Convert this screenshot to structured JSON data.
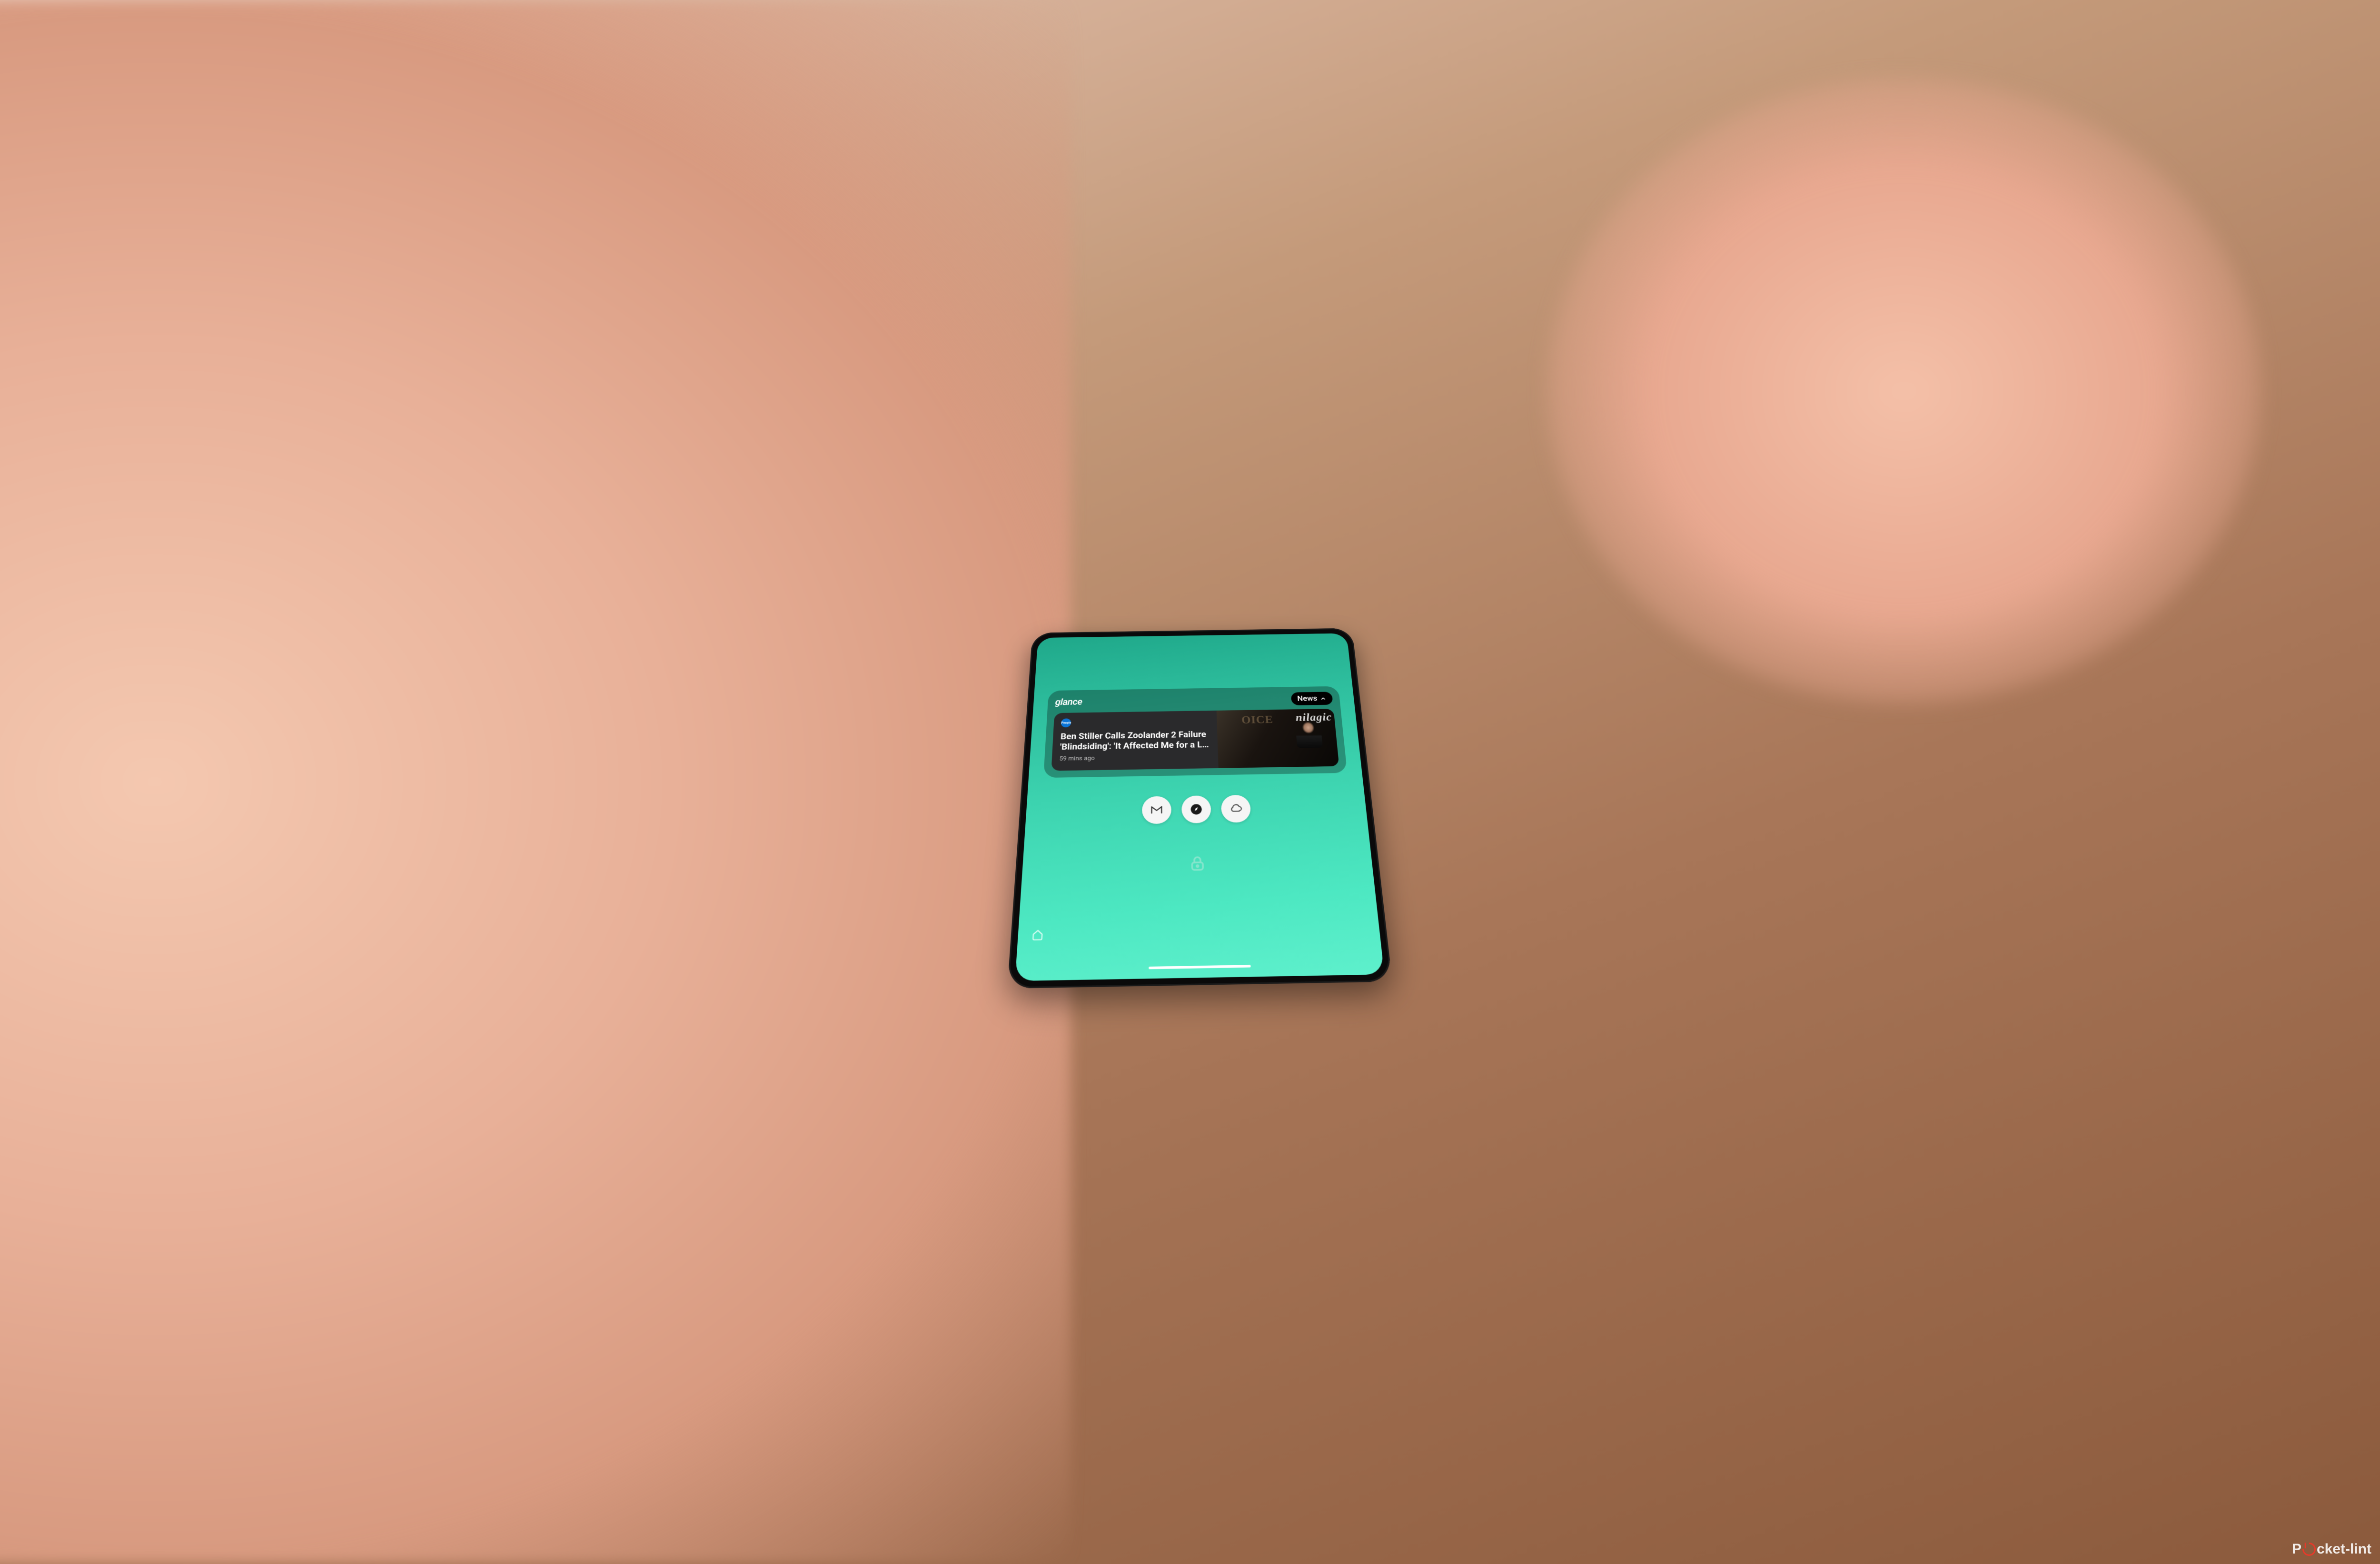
{
  "widget": {
    "brand": "glance",
    "category_label": "News",
    "publisher": "People",
    "headline": "Ben Stiller Calls Zoolander 2 Failure 'Blindsiding': 'It Affected Me for a L…",
    "timestamp": "59 mins ago",
    "bg_word_1": "OICE",
    "bg_word_2": "nilagic"
  },
  "shortcuts": [
    {
      "name": "gmail-icon"
    },
    {
      "name": "compass-icon"
    },
    {
      "name": "cloud-icon"
    }
  ],
  "watermark": {
    "prefix": "P",
    "suffix": "cket-lint"
  }
}
